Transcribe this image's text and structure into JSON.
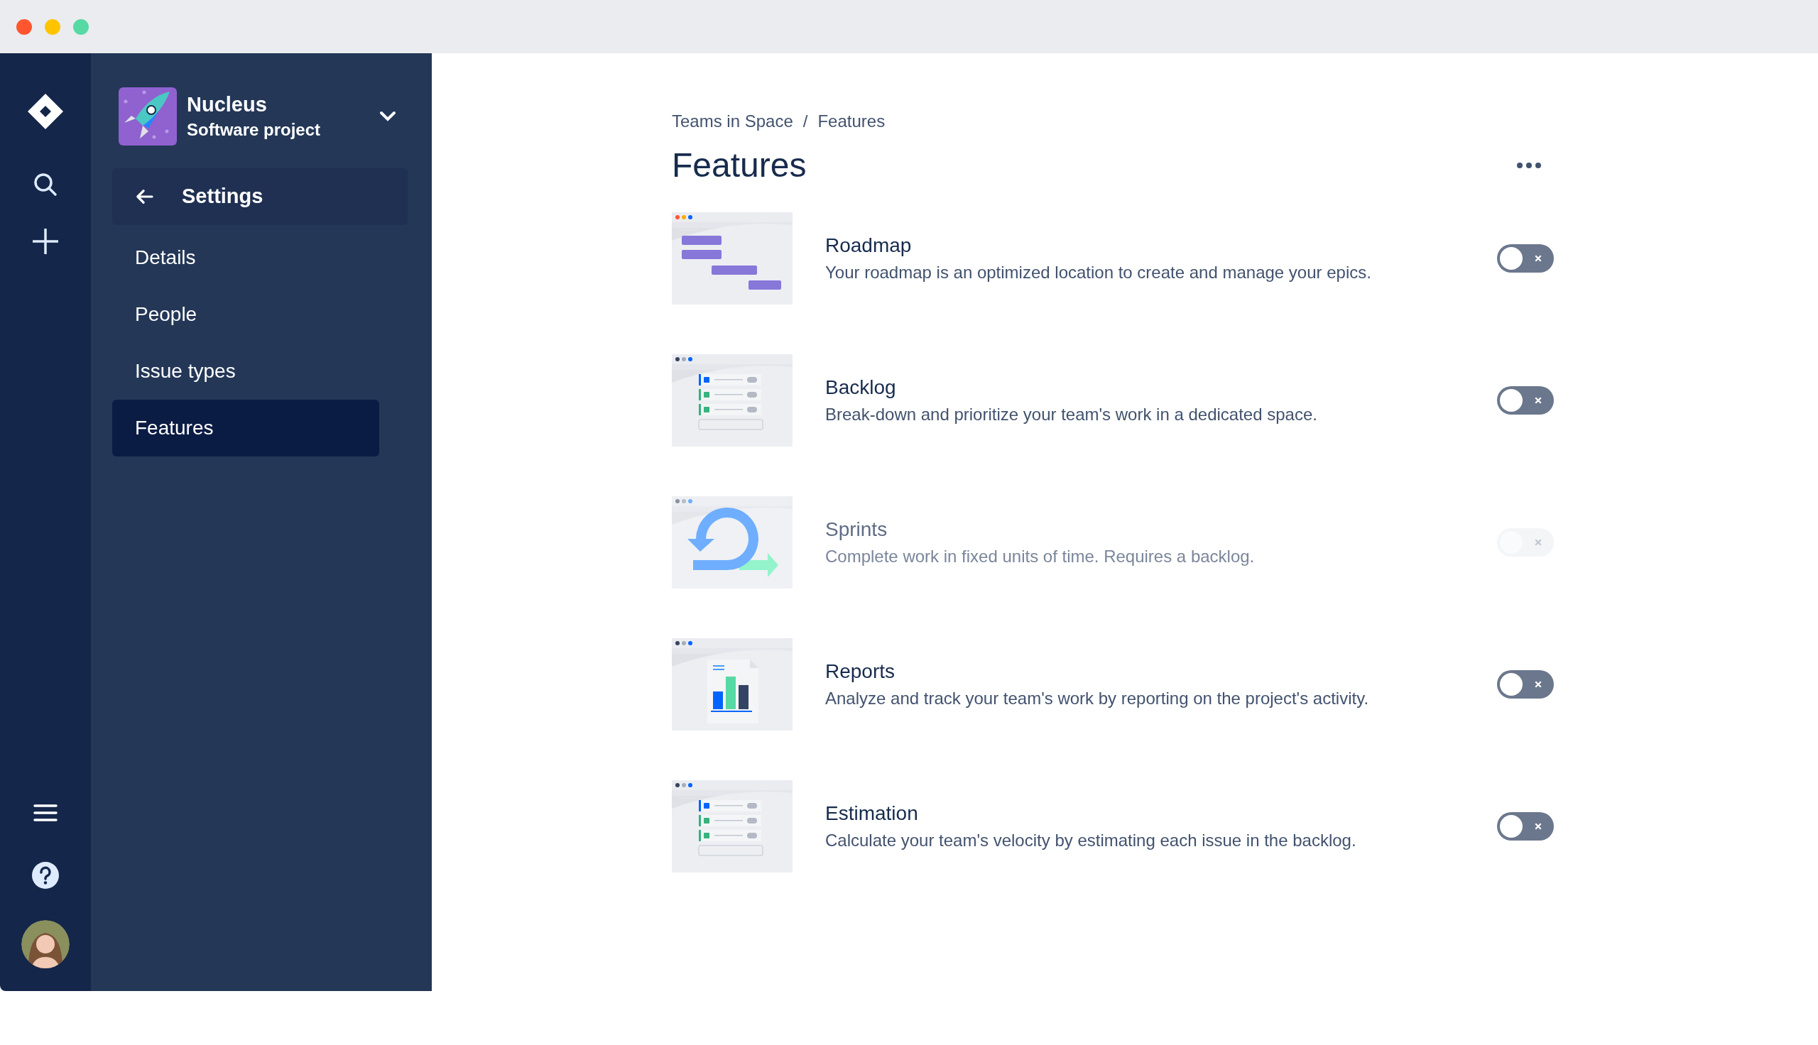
{
  "project": {
    "name": "Nucleus",
    "type": "Software project"
  },
  "back_button": {
    "label": "Settings"
  },
  "nav_items": [
    {
      "label": "Details",
      "selected": false
    },
    {
      "label": "People",
      "selected": false
    },
    {
      "label": "Issue types",
      "selected": false
    },
    {
      "label": "Features",
      "selected": true
    }
  ],
  "breadcrumbs": [
    "Teams in Space",
    "Features"
  ],
  "breadcrumb_separator": "/",
  "page_title": "Features",
  "features": [
    {
      "kind": "roadmap",
      "title": "Roadmap",
      "description": "Your roadmap is an optimized location to create and manage your epics.",
      "on": false,
      "disabled": false
    },
    {
      "kind": "backlog",
      "title": "Backlog",
      "description": "Break-down and prioritize your team's work in a dedicated space.",
      "on": false,
      "disabled": false
    },
    {
      "kind": "sprints",
      "title": "Sprints",
      "description": "Complete work in fixed units of time. Requires a backlog.",
      "on": false,
      "disabled": true
    },
    {
      "kind": "reports",
      "title": "Reports",
      "description": "Analyze and track your team's work by reporting on the project's activity.",
      "on": false,
      "disabled": false
    },
    {
      "kind": "estimation",
      "title": "Estimation",
      "description": "Calculate your team's velocity by estimating each issue in the backlog.",
      "on": false,
      "disabled": false
    }
  ]
}
